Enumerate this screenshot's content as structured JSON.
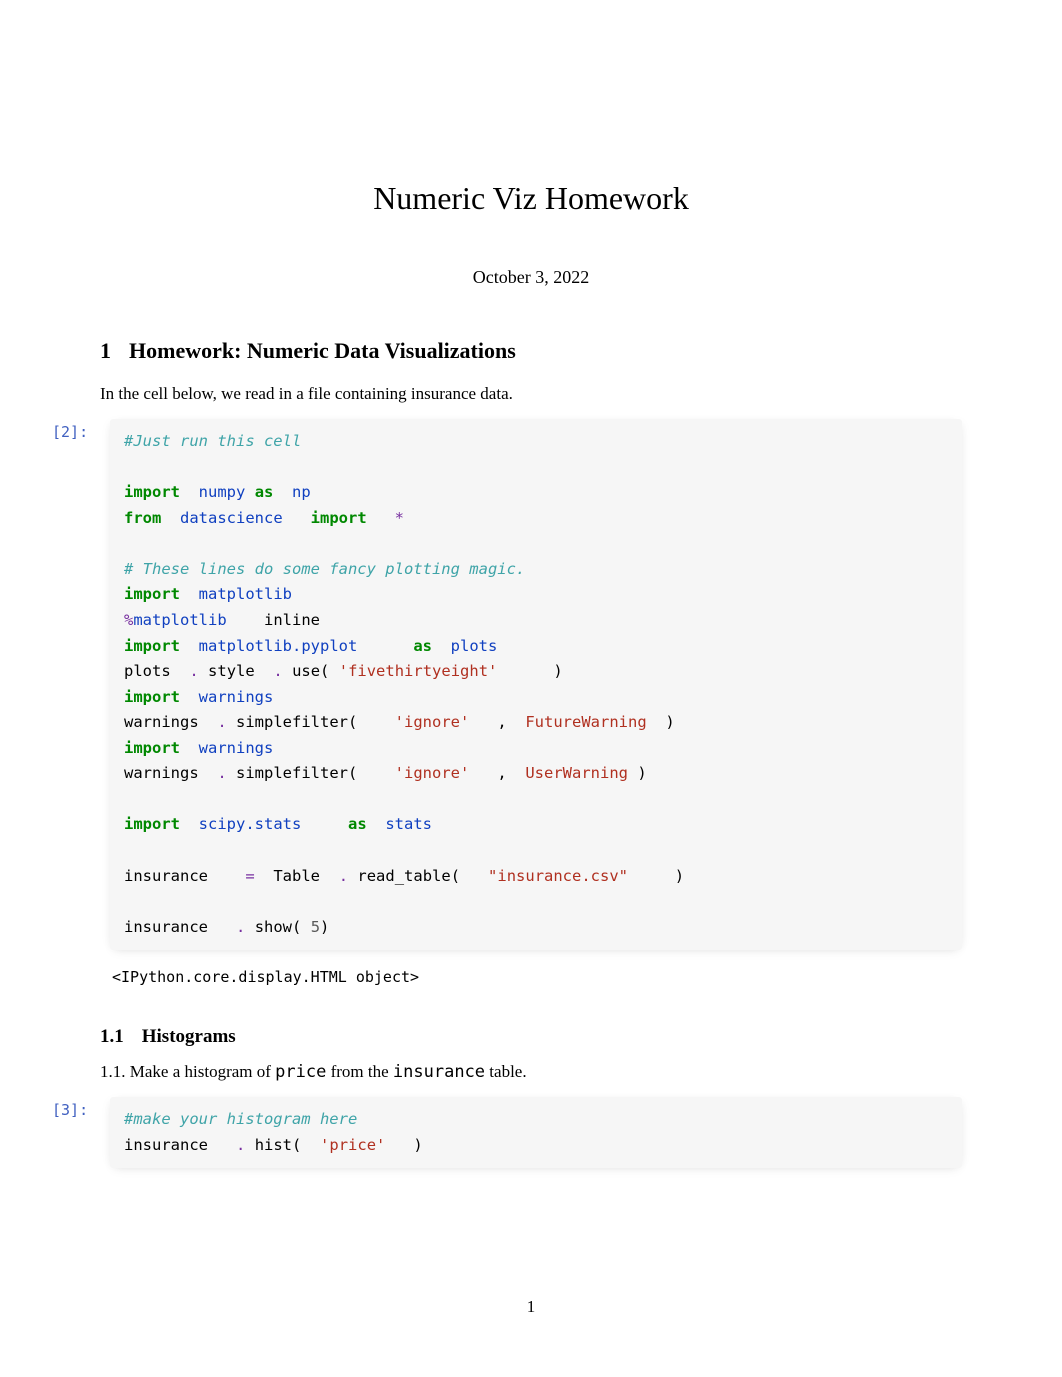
{
  "title": "Numeric Viz Homework",
  "date": "October 3, 2022",
  "section1": {
    "number": "1",
    "heading": "Homework: Numeric Data Visualizations",
    "intro": "In the cell below, we read in a file containing insurance data."
  },
  "cell2": {
    "prompt": "[2]:",
    "tokens": {
      "c1": "#Just run this cell",
      "c2": "# These lines do some fancy plotting magic.",
      "import": "import",
      "from": "from",
      "as": "as",
      "numpy": "numpy",
      "np": "np",
      "datascience": "datascience",
      "star": "*",
      "matplotlib": "matplotlib",
      "pct": "%",
      "mpl_magic": "matplotlib",
      "inline": "inline",
      "pyplot": "matplotlib.pyplot",
      "plots": "plots",
      "plots2": "plots",
      "dot": ".",
      "style": "style",
      "use": "use(",
      "fte": "'fivethirtyeight'",
      "rparen": ")",
      "warnings": "warnings",
      "warnings2": "warnings",
      "simplefilter": "simplefilter(",
      "ignore": "'ignore'",
      "comma": ",",
      "FutureWarning": "FutureWarning",
      "UserWarning": "UserWarning",
      "scipystats": "scipy.stats",
      "stats": "stats",
      "insurance": "insurance",
      "eq": "=",
      "Table": "Table",
      "read_table": "read_table(",
      "csv": "\"insurance.csv\"",
      "show": "show(",
      "five": "5"
    },
    "output": "<IPython.core.display.HTML object>"
  },
  "subsection11": {
    "number": "1.1",
    "heading": "Histograms",
    "task_prefix": "1.1. Make a histogram of",
    "task_code1": "price",
    "task_mid": "from the",
    "task_code2": "insurance",
    "task_suffix": "table."
  },
  "cell3": {
    "prompt": "[3]:",
    "tokens": {
      "c1": "#make your histogram here",
      "insurance": "insurance",
      "dot": ".",
      "hist": "hist(",
      "price": "'price'",
      "rparen": ")"
    }
  },
  "page_number": "1"
}
